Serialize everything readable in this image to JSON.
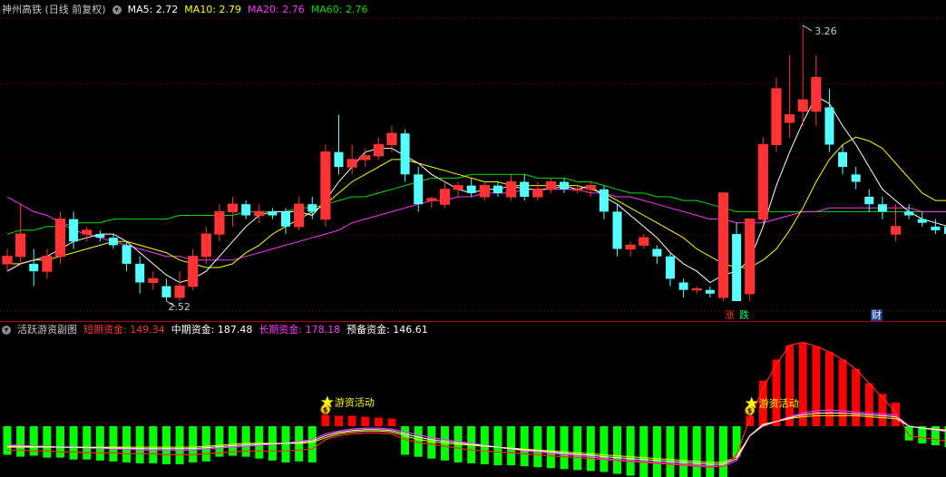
{
  "main_panel": {
    "title": "神州高铁 (日线 前复权)",
    "ma5": "MA5: 2.72",
    "ma10": "MA10: 2.79",
    "ma20": "MA20: 2.76",
    "ma60": "MA60: 2.76",
    "price_high_label": "3.26",
    "price_low_label": "2.52",
    "tag_up": "涨",
    "tag_down": "跌",
    "tag_fin": "财"
  },
  "sub_panel": {
    "title": "活跃游资副图",
    "short_label": "短期资金: 149.34",
    "mid_label": "中期资金: 187.48",
    "long_label": "长期资金: 178.18",
    "reserve_label": "预备资金: 146.61",
    "signal_label_1": "游资活动",
    "signal_label_2": "游资活动"
  },
  "colors": {
    "up": "#ff3333",
    "down": "#54ffff",
    "ma5": "#ffffff",
    "ma10": "#ffff00",
    "ma20": "#ff33ff",
    "ma60": "#00e000",
    "grid": "#8b0000",
    "bar_green": "#00ff00",
    "bar_red": "#ff0000"
  },
  "chart_data": [
    {
      "type": "candlestick",
      "ohlc": [
        [
          2.62,
          2.66,
          2.6,
          2.64
        ],
        [
          2.64,
          2.78,
          2.62,
          2.7
        ],
        [
          2.62,
          2.66,
          2.56,
          2.6
        ],
        [
          2.6,
          2.66,
          2.58,
          2.64
        ],
        [
          2.64,
          2.76,
          2.62,
          2.74
        ],
        [
          2.74,
          2.76,
          2.66,
          2.68
        ],
        [
          2.7,
          2.72,
          2.68,
          2.71
        ],
        [
          2.7,
          2.71,
          2.68,
          2.69
        ],
        [
          2.69,
          2.7,
          2.66,
          2.67
        ],
        [
          2.67,
          2.68,
          2.6,
          2.62
        ],
        [
          2.62,
          2.64,
          2.54,
          2.57
        ],
        [
          2.57,
          2.6,
          2.55,
          2.58
        ],
        [
          2.56,
          2.58,
          2.52,
          2.53
        ],
        [
          2.53,
          2.6,
          2.52,
          2.56
        ],
        [
          2.56,
          2.66,
          2.55,
          2.64
        ],
        [
          2.64,
          2.72,
          2.62,
          2.7
        ],
        [
          2.7,
          2.78,
          2.68,
          2.76
        ],
        [
          2.76,
          2.8,
          2.72,
          2.78
        ],
        [
          2.78,
          2.79,
          2.74,
          2.75
        ],
        [
          2.75,
          2.78,
          2.73,
          2.76
        ],
        [
          2.76,
          2.77,
          2.74,
          2.75
        ],
        [
          2.76,
          2.77,
          2.7,
          2.72
        ],
        [
          2.72,
          2.8,
          2.71,
          2.78
        ],
        [
          2.78,
          2.8,
          2.74,
          2.76
        ],
        [
          2.74,
          2.94,
          2.72,
          2.92
        ],
        [
          2.92,
          3.02,
          2.86,
          2.88
        ],
        [
          2.88,
          2.94,
          2.86,
          2.9
        ],
        [
          2.9,
          2.93,
          2.88,
          2.91
        ],
        [
          2.91,
          2.96,
          2.9,
          2.94
        ],
        [
          2.94,
          2.99,
          2.92,
          2.97
        ],
        [
          2.97,
          2.98,
          2.84,
          2.86
        ],
        [
          2.86,
          2.88,
          2.76,
          2.78
        ],
        [
          2.79,
          2.8,
          2.77,
          2.795
        ],
        [
          2.78,
          2.84,
          2.77,
          2.82
        ],
        [
          2.82,
          2.84,
          2.8,
          2.83
        ],
        [
          2.83,
          2.85,
          2.8,
          2.81
        ],
        [
          2.8,
          2.84,
          2.79,
          2.83
        ],
        [
          2.83,
          2.84,
          2.8,
          2.81
        ],
        [
          2.8,
          2.86,
          2.79,
          2.84
        ],
        [
          2.84,
          2.86,
          2.79,
          2.8
        ],
        [
          2.8,
          2.84,
          2.79,
          2.82
        ],
        [
          2.82,
          2.85,
          2.81,
          2.84
        ],
        [
          2.84,
          2.85,
          2.81,
          2.82
        ],
        [
          2.82,
          2.83,
          2.81,
          2.82
        ],
        [
          2.82,
          2.84,
          2.8,
          2.83
        ],
        [
          2.82,
          2.83,
          2.74,
          2.76
        ],
        [
          2.76,
          2.78,
          2.64,
          2.66
        ],
        [
          2.66,
          2.68,
          2.64,
          2.67
        ],
        [
          2.67,
          2.7,
          2.66,
          2.69
        ],
        [
          2.66,
          2.67,
          2.62,
          2.64
        ],
        [
          2.64,
          2.65,
          2.56,
          2.58
        ],
        [
          2.57,
          2.58,
          2.53,
          2.55
        ],
        [
          2.55,
          2.56,
          2.54,
          2.553
        ],
        [
          2.55,
          2.56,
          2.53,
          2.54
        ],
        [
          2.53,
          2.81,
          2.52,
          2.81
        ],
        [
          2.7,
          2.73,
          2.52,
          2.52
        ],
        [
          2.54,
          2.74,
          2.52,
          2.74
        ],
        [
          2.74,
          2.96,
          2.73,
          2.94
        ],
        [
          2.94,
          3.12,
          2.92,
          3.09
        ],
        [
          3.0,
          3.18,
          2.96,
          3.02
        ],
        [
          3.03,
          3.26,
          2.99,
          3.06
        ],
        [
          3.03,
          3.18,
          2.99,
          3.12
        ],
        [
          3.04,
          3.09,
          2.92,
          2.94
        ],
        [
          2.92,
          2.94,
          2.86,
          2.88
        ],
        [
          2.86,
          2.88,
          2.82,
          2.84
        ],
        [
          2.8,
          2.82,
          2.76,
          2.78
        ],
        [
          2.78,
          2.8,
          2.74,
          2.76
        ],
        [
          2.7,
          2.78,
          2.68,
          2.72
        ],
        [
          2.76,
          2.78,
          2.74,
          2.75
        ],
        [
          2.74,
          2.76,
          2.72,
          2.73
        ],
        [
          2.72,
          2.74,
          2.7,
          2.71
        ],
        [
          2.72,
          2.73,
          2.68,
          2.7
        ]
      ],
      "ma5": [
        2.6,
        2.62,
        2.63,
        2.64,
        2.66,
        2.68,
        2.69,
        2.7,
        2.7,
        2.68,
        2.65,
        2.62,
        2.59,
        2.57,
        2.58,
        2.6,
        2.64,
        2.68,
        2.72,
        2.75,
        2.76,
        2.76,
        2.76,
        2.75,
        2.79,
        2.84,
        2.88,
        2.92,
        2.93,
        2.93,
        2.91,
        2.89,
        2.86,
        2.84,
        2.82,
        2.81,
        2.82,
        2.82,
        2.83,
        2.82,
        2.82,
        2.82,
        2.83,
        2.82,
        2.83,
        2.8,
        2.78,
        2.75,
        2.72,
        2.69,
        2.65,
        2.62,
        2.6,
        2.57,
        2.59,
        2.6,
        2.63,
        2.72,
        2.83,
        2.92,
        3.0,
        3.07,
        3.05,
        2.99,
        2.94,
        2.88,
        2.82,
        2.79,
        2.76,
        2.74,
        2.73,
        2.72
      ],
      "ma10": [
        2.62,
        2.62,
        2.63,
        2.63,
        2.64,
        2.65,
        2.66,
        2.67,
        2.68,
        2.68,
        2.67,
        2.66,
        2.65,
        2.63,
        2.62,
        2.61,
        2.61,
        2.62,
        2.65,
        2.67,
        2.7,
        2.72,
        2.74,
        2.76,
        2.78,
        2.81,
        2.84,
        2.86,
        2.88,
        2.9,
        2.9,
        2.89,
        2.88,
        2.87,
        2.86,
        2.85,
        2.84,
        2.84,
        2.83,
        2.83,
        2.83,
        2.83,
        2.83,
        2.83,
        2.82,
        2.81,
        2.79,
        2.77,
        2.75,
        2.73,
        2.71,
        2.69,
        2.66,
        2.64,
        2.62,
        2.61,
        2.61,
        2.63,
        2.66,
        2.71,
        2.77,
        2.84,
        2.9,
        2.94,
        2.96,
        2.95,
        2.93,
        2.89,
        2.85,
        2.81,
        2.79,
        2.79
      ],
      "ma20": [
        2.8,
        2.78,
        2.76,
        2.75,
        2.73,
        2.71,
        2.7,
        2.69,
        2.68,
        2.67,
        2.66,
        2.65,
        2.64,
        2.64,
        2.63,
        2.63,
        2.63,
        2.63,
        2.64,
        2.65,
        2.66,
        2.67,
        2.68,
        2.69,
        2.7,
        2.71,
        2.73,
        2.74,
        2.75,
        2.76,
        2.77,
        2.78,
        2.79,
        2.79,
        2.8,
        2.8,
        2.81,
        2.81,
        2.81,
        2.82,
        2.82,
        2.82,
        2.82,
        2.82,
        2.81,
        2.81,
        2.8,
        2.8,
        2.79,
        2.78,
        2.77,
        2.76,
        2.75,
        2.74,
        2.74,
        2.73,
        2.73,
        2.73,
        2.74,
        2.75,
        2.76,
        2.76,
        2.77,
        2.77,
        2.77,
        2.77,
        2.77,
        2.77,
        2.77,
        2.76,
        2.76,
        2.76
      ],
      "ma60": [
        2.7,
        2.71,
        2.71,
        2.72,
        2.72,
        2.73,
        2.73,
        2.73,
        2.74,
        2.74,
        2.74,
        2.74,
        2.74,
        2.75,
        2.75,
        2.75,
        2.75,
        2.75,
        2.76,
        2.76,
        2.76,
        2.76,
        2.77,
        2.77,
        2.78,
        2.79,
        2.8,
        2.8,
        2.81,
        2.82,
        2.83,
        2.84,
        2.85,
        2.85,
        2.85,
        2.86,
        2.86,
        2.86,
        2.86,
        2.86,
        2.85,
        2.85,
        2.85,
        2.84,
        2.84,
        2.83,
        2.82,
        2.81,
        2.81,
        2.8,
        2.8,
        2.79,
        2.79,
        2.78,
        2.77,
        2.76,
        2.76,
        2.76,
        2.76,
        2.76,
        2.76,
        2.76,
        2.76,
        2.76,
        2.76,
        2.76,
        2.76,
        2.76,
        2.76,
        2.76,
        2.76,
        2.76
      ]
    },
    {
      "type": "bar",
      "title": "活跃游资副图",
      "values": [
        -30,
        -32,
        -31,
        -33,
        -33,
        -35,
        -35,
        -36,
        -37,
        -38,
        -39,
        -39,
        -40,
        -40,
        -38,
        -37,
        -32,
        -31,
        -32,
        -34,
        -36,
        -38,
        -37,
        -38,
        12,
        11,
        11,
        10,
        9,
        8,
        -30,
        -32,
        -34,
        -36,
        -38,
        -39,
        -40,
        -41,
        -41,
        -42,
        -43,
        -44,
        -45,
        -46,
        -47,
        -48,
        -50,
        -52,
        -54,
        -56,
        -58,
        -60,
        -64,
        -66,
        -62,
        -32,
        11,
        48,
        70,
        85,
        88,
        84,
        78,
        70,
        60,
        45,
        34,
        25,
        -15,
        -18,
        -20,
        -22
      ],
      "line_red": [
        -25,
        -25,
        -26,
        -26,
        -27,
        -27,
        -28,
        -28,
        -28,
        -29,
        -29,
        -29,
        -30,
        -30,
        -30,
        -29,
        -28,
        -27,
        -26,
        -26,
        -26,
        -26,
        -25,
        -24,
        -14,
        -10,
        -8,
        -7,
        -7,
        -8,
        -14,
        -17,
        -19,
        -21,
        -23,
        -25,
        -26,
        -27,
        -28,
        -29,
        -30,
        -31,
        -32,
        -33,
        -34,
        -35,
        -36,
        -37,
        -38,
        -39,
        -40,
        -41,
        -42,
        -43,
        -42,
        -30,
        8,
        40,
        65,
        85,
        88,
        84,
        78,
        70,
        60,
        45,
        30,
        15,
        -10,
        -12,
        -14,
        -16
      ],
      "line_magenta": [
        -20,
        -20,
        -21,
        -21,
        -22,
        -22,
        -23,
        -23,
        -24,
        -24,
        -25,
        -25,
        -25,
        -25,
        -25,
        -24,
        -23,
        -22,
        -21,
        -20,
        -19,
        -18,
        -16,
        -14,
        -8,
        -5,
        -3,
        -2,
        -2,
        -3,
        -6,
        -9,
        -12,
        -14,
        -16,
        -18,
        -20,
        -22,
        -24,
        -26,
        -27,
        -28,
        -30,
        -31,
        -32,
        -34,
        -35,
        -36,
        -37,
        -38,
        -39,
        -40,
        -41,
        -42,
        -42,
        -36,
        -10,
        0,
        5,
        10,
        14,
        16,
        17,
        16,
        15,
        14,
        13,
        12,
        0,
        -2,
        -4,
        -6
      ],
      "line_yellow": [
        -22,
        -22,
        -22,
        -22,
        -22,
        -22,
        -22,
        -22,
        -22,
        -22,
        -22,
        -22,
        -22,
        -22,
        -22,
        -21,
        -20,
        -19,
        -18,
        -18,
        -18,
        -18,
        -18,
        -17,
        -12,
        -8,
        -6,
        -5,
        -5,
        -6,
        -10,
        -14,
        -16,
        -18,
        -19,
        -20,
        -21,
        -22,
        -23,
        -24,
        -25,
        -26,
        -27,
        -28,
        -29,
        -30,
        -31,
        -32,
        -33,
        -34,
        -35,
        -36,
        -37,
        -38,
        -38,
        -32,
        -10,
        2,
        5,
        8,
        10,
        11,
        11,
        11,
        11,
        10,
        9,
        8,
        0,
        -2,
        -3,
        -4
      ],
      "signal_indices": [
        24,
        56
      ]
    }
  ]
}
